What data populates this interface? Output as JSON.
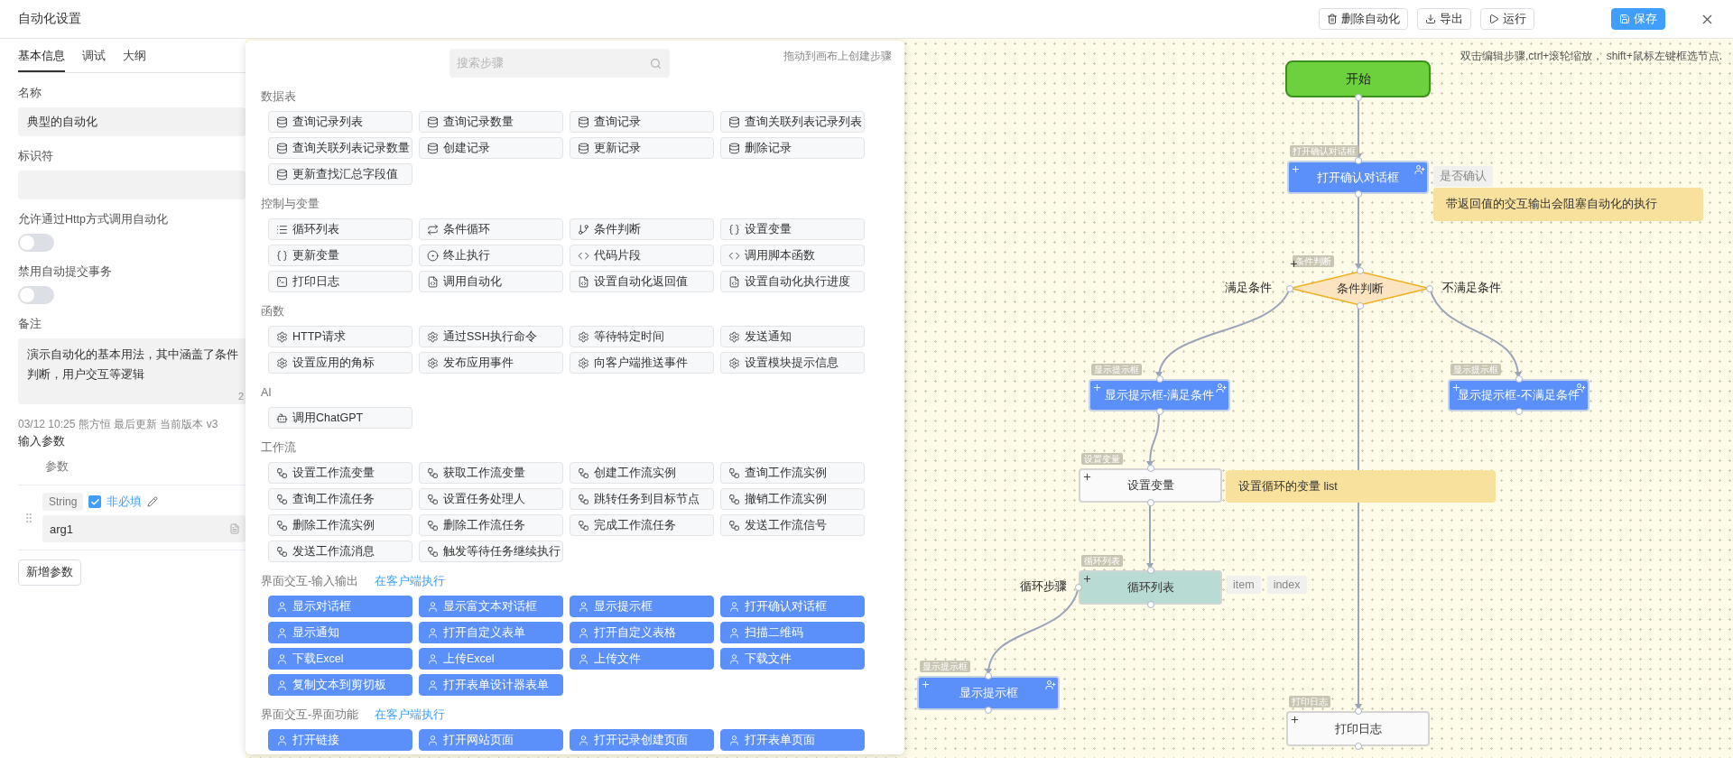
{
  "window": {
    "title": "自动化设置"
  },
  "toolbar": {
    "buttons": [
      {
        "label": "删除自动化",
        "kind": "delete"
      },
      {
        "label": "导出",
        "kind": "export"
      },
      {
        "label": "运行",
        "kind": "run"
      },
      {
        "label": "保存",
        "kind": "save"
      }
    ]
  },
  "sidebar": {
    "tabs": [
      {
        "label": "基本信息",
        "selected": true
      },
      {
        "label": "调试",
        "selected": false
      },
      {
        "label": "大纲",
        "selected": false
      }
    ],
    "fields": [
      {
        "kind": "text",
        "label": "名称",
        "value": "典型的自动化"
      },
      {
        "kind": "text",
        "label": "标识符"
      },
      {
        "kind": "switch",
        "label": "允许通过Http方式调用自动化",
        "on": false
      },
      {
        "kind": "switch",
        "label": "禁用自动提交事务",
        "on": false
      },
      {
        "kind": "textarea",
        "label": "备注",
        "value": "演示自动化的基本用法，其中涵盖了条件判断，用户交互等逻辑",
        "counter": "2"
      }
    ],
    "meta": "03/12 10:25 熊方恒 最后更新 当前版本 v3",
    "params": {
      "title": "输入参数",
      "column": "参数",
      "add_button": "新增参数",
      "rows": [
        {
          "type": "String",
          "checked": true,
          "option": "非必填",
          "name": "arg1"
        }
      ]
    }
  },
  "palette": {
    "search": {
      "placeholder": "搜索步骤"
    },
    "hint": "拖动到画布上创建步骤",
    "sections": [
      {
        "title": "数据表",
        "items": [
          {
            "label": "查询记录列表",
            "kind": "data"
          },
          {
            "label": "查询记录数量",
            "kind": "data"
          },
          {
            "label": "查询记录",
            "kind": "data"
          },
          {
            "label": "查询关联列表记录列表",
            "kind": "data"
          },
          {
            "label": "查询关联列表记录数量",
            "kind": "data"
          },
          {
            "label": "创建记录",
            "kind": "data"
          },
          {
            "label": "更新记录",
            "kind": "data"
          },
          {
            "label": "删除记录",
            "kind": "data"
          },
          {
            "label": "更新查找汇总字段值",
            "kind": "data"
          }
        ]
      },
      {
        "title": "控制与变量",
        "items": [
          {
            "label": "循环列表",
            "kind": "list"
          },
          {
            "label": "条件循环",
            "kind": "loop"
          },
          {
            "label": "条件判断",
            "kind": "branch"
          },
          {
            "label": "设置变量",
            "kind": "variable"
          },
          {
            "label": "更新变量",
            "kind": "variable"
          },
          {
            "label": "终止执行",
            "kind": "stop"
          },
          {
            "label": "代码片段",
            "kind": "code"
          },
          {
            "label": "调用脚本函数",
            "kind": "code"
          },
          {
            "label": "打印日志",
            "kind": "log"
          },
          {
            "label": "调用自动化",
            "kind": "automation"
          },
          {
            "label": "设置自动化返回值",
            "kind": "automation"
          },
          {
            "label": "设置自动化执行进度",
            "kind": "automation"
          }
        ]
      },
      {
        "title": "函数",
        "items": [
          {
            "label": "HTTP请求",
            "kind": "function"
          },
          {
            "label": "通过SSH执行命令",
            "kind": "function"
          },
          {
            "label": "等待特定时间",
            "kind": "function"
          },
          {
            "label": "发送通知",
            "kind": "function"
          },
          {
            "label": "设置应用的角标",
            "kind": "function"
          },
          {
            "label": "发布应用事件",
            "kind": "function"
          },
          {
            "label": "向客户端推送事件",
            "kind": "function"
          },
          {
            "label": "设置模块提示信息",
            "kind": "function"
          }
        ]
      },
      {
        "title": "AI",
        "items": [
          {
            "label": "调用ChatGPT",
            "kind": "ai"
          }
        ]
      },
      {
        "title": "工作流",
        "items": [
          {
            "label": "设置工作流变量",
            "kind": "workflow"
          },
          {
            "label": "获取工作流变量",
            "kind": "workflow"
          },
          {
            "label": "创建工作流实例",
            "kind": "workflow"
          },
          {
            "label": "查询工作流实例",
            "kind": "workflow"
          },
          {
            "label": "查询工作流任务",
            "kind": "workflow"
          },
          {
            "label": "设置任务处理人",
            "kind": "workflow"
          },
          {
            "label": "跳转任务到目标节点",
            "kind": "workflow"
          },
          {
            "label": "撤销工作流实例",
            "kind": "workflow"
          },
          {
            "label": "删除工作流实例",
            "kind": "workflow"
          },
          {
            "label": "删除工作流任务",
            "kind": "workflow"
          },
          {
            "label": "完成工作流任务",
            "kind": "workflow"
          },
          {
            "label": "发送工作流信号",
            "kind": "workflow"
          },
          {
            "label": "发送工作流消息",
            "kind": "workflow"
          },
          {
            "label": "触发等待任务继续执行",
            "kind": "workflow"
          }
        ]
      },
      {
        "title": "界面交互-输入输出",
        "tag": "在客户端执行",
        "items": [
          {
            "label": "显示对话框",
            "kind": "interaction"
          },
          {
            "label": "显示富文本对话框",
            "kind": "interaction"
          },
          {
            "label": "显示提示框",
            "kind": "interaction"
          },
          {
            "label": "打开确认对话框",
            "kind": "interaction"
          },
          {
            "label": "显示通知",
            "kind": "interaction"
          },
          {
            "label": "打开自定义表单",
            "kind": "interaction"
          },
          {
            "label": "打开自定义表格",
            "kind": "interaction"
          },
          {
            "label": "扫描二维码",
            "kind": "interaction"
          },
          {
            "label": "下载Excel",
            "kind": "interaction"
          },
          {
            "label": "上传Excel",
            "kind": "interaction"
          },
          {
            "label": "上传文件",
            "kind": "interaction"
          },
          {
            "label": "下载文件",
            "kind": "interaction"
          },
          {
            "label": "复制文本到剪切板",
            "kind": "interaction"
          },
          {
            "label": "打开表单设计器表单",
            "kind": "interaction"
          }
        ]
      },
      {
        "title": "界面交互-界面功能",
        "tag": "在客户端执行",
        "items": [
          {
            "label": "打开链接",
            "kind": "interaction"
          },
          {
            "label": "打开网站页面",
            "kind": "interaction"
          },
          {
            "label": "打开记录创建页面",
            "kind": "interaction"
          },
          {
            "label": "打开表单页面",
            "kind": "interaction"
          }
        ]
      }
    ]
  },
  "canvas": {
    "hint": "双击编辑步骤,ctrl+滚轮缩放， shift+鼠标左键框选节点.",
    "nodes": [
      {
        "kind": "start",
        "label": "开始"
      },
      {
        "kind": "interaction",
        "badge": "打开确认对话框",
        "label": "打开确认对话框",
        "outputs": [
          "是否确认"
        ]
      },
      {
        "kind": "condition",
        "badge": "条件判断",
        "label": "条件判断"
      },
      {
        "kind": "interaction",
        "badge": "显示提示框",
        "label": "显示提示框-满足条件"
      },
      {
        "kind": "interaction",
        "badge": "显示提示框",
        "label": "显示提示框-不满足条件"
      },
      {
        "kind": "action",
        "badge": "设置变量",
        "label": "设置变量"
      },
      {
        "kind": "loop",
        "badge": "循环列表",
        "label": "循环列表",
        "outputs": [
          "item",
          "index"
        ]
      },
      {
        "kind": "interaction",
        "badge": "显示提示框",
        "label": "显示提示框"
      },
      {
        "kind": "action",
        "badge": "打印日志",
        "label": "打印日志"
      }
    ],
    "notes": [
      "带返回值的交互输出会阻塞自动化的执行",
      "设置循环的变量 list"
    ],
    "branch_labels": [
      "满足条件",
      "不满足条件",
      "循环步骤"
    ]
  }
}
